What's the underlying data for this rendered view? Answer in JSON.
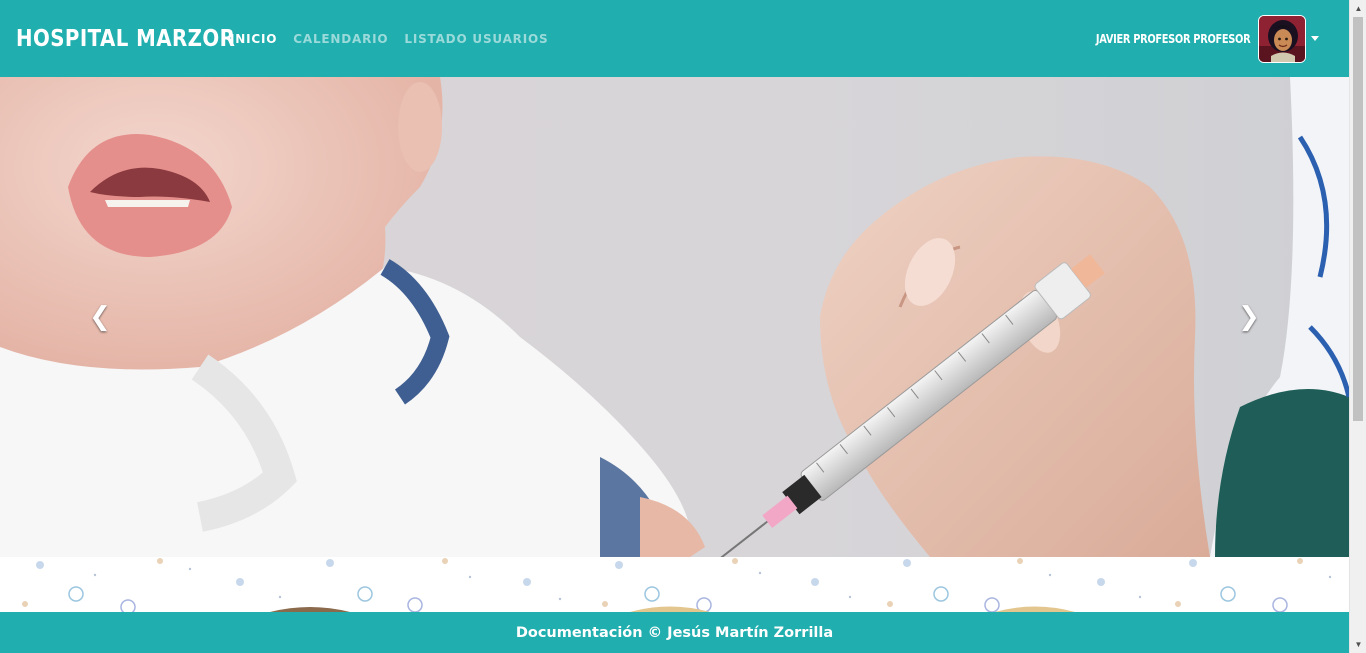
{
  "navbar": {
    "brand": "HOSPITAL MARZOR",
    "links": [
      {
        "label": "INICIO",
        "active": true
      },
      {
        "label": "CALENDARIO",
        "active": false
      },
      {
        "label": "LISTADO USUARIOS",
        "active": false
      }
    ],
    "user_name": "JAVIER PROFESOR PROFESOR",
    "avatar_icon": "user-avatar",
    "caret_icon": "caret-down-icon"
  },
  "carousel": {
    "prev_icon": "chevron-left-icon",
    "next_icon": "chevron-right-icon",
    "prev_glyph": "❮",
    "next_glyph": "❯"
  },
  "footer": {
    "text": "Documentación © Jesús Martín Zorrilla"
  },
  "colors": {
    "primary": "#21aeae",
    "text_on_primary": "#ffffff"
  }
}
